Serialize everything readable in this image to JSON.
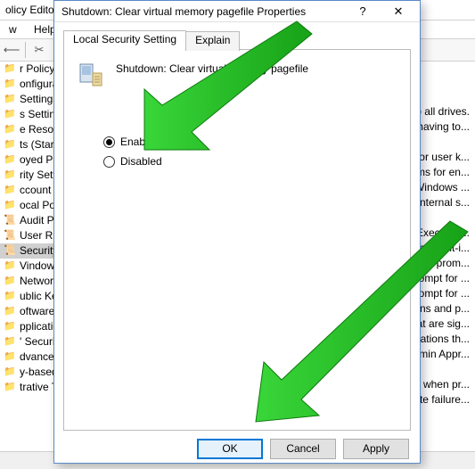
{
  "editor": {
    "title_fragment": "olicy Editor",
    "menu": {
      "view": "w",
      "help": "Help"
    },
    "tree": [
      {
        "icon": "folder",
        "label": "r Policy"
      },
      {
        "icon": "folder",
        "label": "onfiguratio"
      },
      {
        "icon": "folder",
        "label": "  Settings"
      },
      {
        "icon": "folder",
        "label": "s Settings"
      },
      {
        "icon": "folder",
        "label": "e Resolutio"
      },
      {
        "icon": "folder",
        "label": "ts (Startup/"
      },
      {
        "icon": "folder",
        "label": "oyed Printe"
      },
      {
        "icon": "folder",
        "label": "rity Settings"
      },
      {
        "icon": "folder",
        "label": "ccount Poli"
      },
      {
        "icon": "folder",
        "label": "ocal Policies"
      },
      {
        "icon": "scroll",
        "label": "Audit Pol"
      },
      {
        "icon": "scroll",
        "label": "User Right"
      },
      {
        "icon": "scroll",
        "label": "Security O",
        "selected": true
      },
      {
        "icon": "folder",
        "label": "Vindows De"
      },
      {
        "icon": "folder",
        "label": "Network List"
      },
      {
        "icon": "folder",
        "label": "ublic Key P"
      },
      {
        "icon": "folder",
        "label": "oftware Res"
      },
      {
        "icon": "folder",
        "label": "pplication ("
      },
      {
        "icon": "folder",
        "label": "' Security P"
      },
      {
        "icon": "folder",
        "label": "dvanced Au"
      },
      {
        "icon": "folder",
        "label": "y-based Qo"
      },
      {
        "icon": "folder",
        "label": "trative Temp"
      }
    ],
    "right_lines": [
      "o all drives.",
      "having to...",
      "",
      "for user k...",
      "ms for en...",
      "Windows ...",
      "internal s...",
      "",
      "Executab...",
      "he Built-i...",
      "s to prom...",
      "ompt for ...",
      "ompt for ...",
      "ons and p...",
      "at are sig...",
      "cations th...",
      "dmin Appr...",
      "",
      "p when pr...",
      "rite failure..."
    ]
  },
  "dialog": {
    "title": "Shutdown: Clear virtual memory pagefile Properties",
    "help_glyph": "?",
    "close_glyph": "✕",
    "tabs": {
      "local": "Local Security Setting",
      "explain": "Explain"
    },
    "header_text": "Shutdown: Clear virtual memory pagefile",
    "radio_enabled": "Enabled",
    "radio_disabled": "Disabled",
    "buttons": {
      "ok": "OK",
      "cancel": "Cancel",
      "apply": "Apply"
    }
  }
}
